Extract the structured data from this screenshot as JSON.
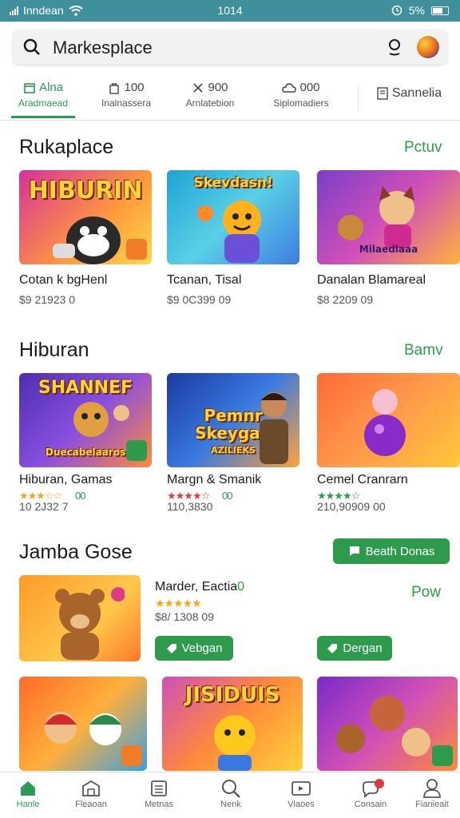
{
  "status_bar": {
    "carrier": "Inndean",
    "time": "1014",
    "battery_pct": "5%"
  },
  "search": {
    "value": "Markesplace"
  },
  "tabs": [
    {
      "top": "Alna",
      "bottom": "Aradmaead",
      "icon": "store-icon"
    },
    {
      "top": "100",
      "bottom": "Inalnassera",
      "icon": "bag-icon"
    },
    {
      "top": "900",
      "bottom": "Arnlatebion",
      "icon": "tools-icon"
    },
    {
      "top": "000",
      "bottom": "Siplomadiers",
      "icon": "cloud-icon"
    },
    {
      "top": "Sannelia",
      "bottom": "",
      "icon": "document-icon"
    }
  ],
  "section1": {
    "title": "Rukaplace",
    "link": "Pctuv",
    "cards": [
      {
        "image_text": "HIBURIN",
        "name": "Cotan k bgHenl",
        "price": "$9 21923 0"
      },
      {
        "image_text": "Skevdasn!",
        "name": "Tcanan, Tisal",
        "price": "$9 0C399 09"
      },
      {
        "image_text": "Milaedlaaa",
        "name": "Danalan Blamareal",
        "price": "$8 2209 09"
      }
    ]
  },
  "section2": {
    "title": "Hiburan",
    "link": "Bamv",
    "cards": [
      {
        "image_text": "SHANNEF",
        "image_sub": "Duecabelaaros",
        "name": "Hiburan, Gamas",
        "stars": "★★★☆☆",
        "rating_tail": "00",
        "price": "10 2J32 7"
      },
      {
        "image_text": "Pemnr Skeygan",
        "image_sub": "AZILIEKS",
        "name": "Margn & Smanik",
        "stars": "★★★★☆",
        "rating_tail": "00",
        "price": "110,3830"
      },
      {
        "image_text": "",
        "image_sub": "",
        "name": "Cemel Cranrarn",
        "stars": "★★★★☆",
        "rating_tail": "",
        "price": "210,90909 00"
      }
    ]
  },
  "section3": {
    "title": "Jamba Gose",
    "header_button": "Beath Donas",
    "link": "Pow",
    "featured": {
      "name": "Marder, Eactia",
      "name_suffix": "0",
      "stars": "★★★★★",
      "price": "$8/ 1308 09",
      "button1": "Vebgan",
      "button2": "Dergan"
    },
    "bottom_cards": [
      {
        "image_text": ""
      },
      {
        "image_text": "JISIDUIS"
      },
      {
        "image_text": ""
      }
    ]
  },
  "bottom_nav": [
    {
      "label": "Hanle",
      "icon": "home-icon"
    },
    {
      "label": "Fleaoan",
      "icon": "store-icon"
    },
    {
      "label": "Metnas",
      "icon": "list-icon"
    },
    {
      "label": "Nenk",
      "icon": "search-icon"
    },
    {
      "label": "Vlaoes",
      "icon": "video-icon"
    },
    {
      "label": "Consain",
      "icon": "chat-icon"
    },
    {
      "label": "Fianieait",
      "icon": "profile-icon"
    }
  ],
  "colors": {
    "accent": "#2e9a4c",
    "status_bar": "#3f8f9c"
  }
}
